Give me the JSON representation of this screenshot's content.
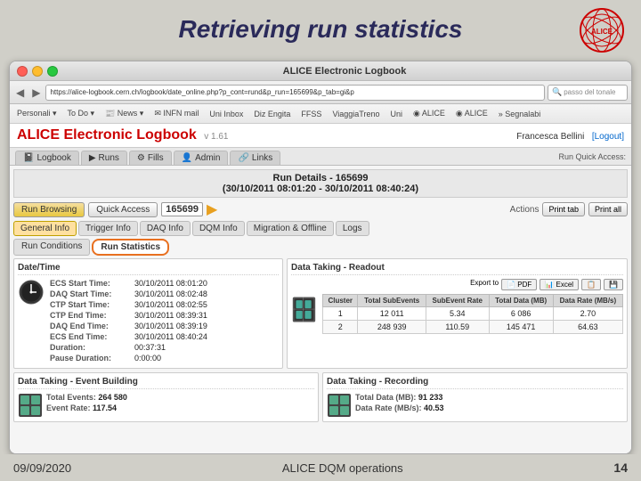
{
  "title": "Retrieving run statistics",
  "alice_logo": "ALICE",
  "browser": {
    "window_title": "ALICE Electronic Logbook",
    "url": "https://alice-logbook.cern.ch/logbook/date_online.php?p_cont=rund&p_run=165699&p_tab=gi&p",
    "search_placeholder": "passo del tonale",
    "bookmarks": [
      "Personali",
      "To Do",
      "News",
      "INFN mail",
      "Uni Inbox",
      "Diz Engita",
      "FFSS",
      "ViaggiaTreno",
      "Uni",
      "ALICE",
      "ALICE",
      "Segnalabi"
    ]
  },
  "logbook": {
    "title": "ALICE Electronic Logbook",
    "version": "v 1.61",
    "user": "Francesca Bellini",
    "logout": "[Logout]",
    "nav_tabs": [
      "Logbook",
      "Runs",
      "Fills",
      "Admin",
      "Links"
    ],
    "quick_access_label": "Run Quick Access:"
  },
  "run_details": {
    "header": "Run Details - 165699",
    "time_range": "(30/10/2011 08:01:20 - 30/10/2011 08:40:24)",
    "run_browsing_label": "Run Browsing",
    "quick_access_label": "Quick Access",
    "run_number": "165699",
    "actions_label": "Actions",
    "print_tab": "Print tab",
    "print_all": "Print all"
  },
  "sub_tabs": [
    "General Info",
    "Trigger Info",
    "DAQ Info",
    "DQM Info",
    "Migration & Offline",
    "Logs"
  ],
  "stats_tabs": [
    "Run Conditions",
    "Run Statistics"
  ],
  "datetime": {
    "section_title": "Date/Time",
    "rows": [
      {
        "label": "ECS Start Time:",
        "value": "30/10/2011 08:01:20"
      },
      {
        "label": "DAQ Start Time:",
        "value": "30/10/2011 08:02:48"
      },
      {
        "label": "CTP Start Time:",
        "value": "30/10/2011 08:02:55"
      },
      {
        "label": "CTP End Time:",
        "value": "30/10/2011 08:39:31"
      },
      {
        "label": "DAQ End Time:",
        "value": "30/10/2011 08:39:19"
      },
      {
        "label": "ECS End Time:",
        "value": "30/10/2011 08:40:24"
      },
      {
        "label": "Duration:",
        "value": "00:37:31"
      },
      {
        "label": "Pause Duration:",
        "value": "0:00:00"
      }
    ]
  },
  "readout": {
    "section_title": "Data Taking - Readout",
    "export_pdf": "PDF",
    "export_excel": "Excel",
    "export_label": "Export to",
    "columns": [
      "Cluster",
      "Total SubEvents",
      "SubEvent Rate",
      "Total Data (MB)",
      "Data Rate (MB/s)"
    ],
    "rows": [
      {
        "cluster": "1",
        "total_subevents": "12 011",
        "subevent_rate": "5.34",
        "total_data": "6 086",
        "data_rate": "2.70"
      },
      {
        "cluster": "2",
        "total_subevents": "248 939",
        "subevent_rate": "110.59",
        "total_data": "145 471",
        "data_rate": "64.63"
      }
    ]
  },
  "event_building": {
    "section_title": "Data Taking - Event Building",
    "total_events_label": "Total Events:",
    "total_events_value": "264 580",
    "event_rate_label": "Event Rate:",
    "event_rate_value": "117.54"
  },
  "recording": {
    "section_title": "Data Taking - Recording",
    "total_data_label": "Total Data (MB):",
    "total_data_value": "91 233",
    "data_rate_label": "Data Rate (MB/s):",
    "data_rate_value": "40.53"
  },
  "bottom": {
    "date": "09/09/2020",
    "center": "ALICE DQM operations",
    "page": "14"
  }
}
